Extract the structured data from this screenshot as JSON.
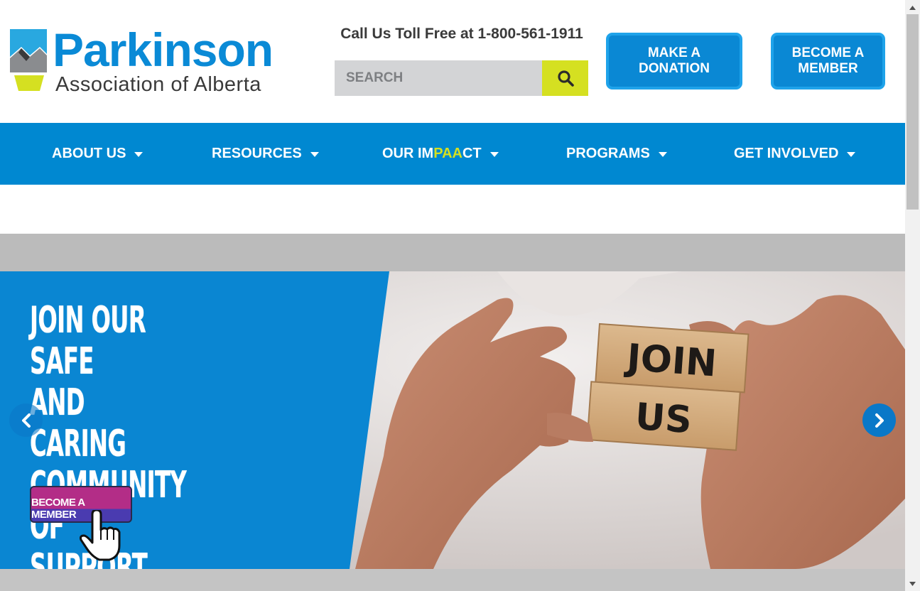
{
  "header": {
    "logo": {
      "title": "Parkinson",
      "subtitle": "Association of Alberta"
    },
    "call": "Call Us Toll Free at 1-800-561-1911",
    "search": {
      "placeholder": "SEARCH"
    },
    "donate_line1": "MAKE A",
    "donate_line2": "DONATION",
    "member_line1": "BECOME A",
    "member_line2": "MEMBER"
  },
  "nav": {
    "items": [
      {
        "label": "ABOUT US"
      },
      {
        "label": "RESOURCES"
      },
      {
        "label_a": "OUR IM",
        "label_b": "PAA",
        "label_c": "CT"
      },
      {
        "label": "PROGRAMS"
      },
      {
        "label": "GET INVOLVED"
      }
    ]
  },
  "hero": {
    "headline": [
      "JOIN OUR SAFE",
      "AND CARING",
      "COMMUNITY OF",
      "SUPPORT"
    ],
    "cta": "BECOME A MEMBER",
    "block_top": "JOIN",
    "block_bottom": "US"
  },
  "colors": {
    "brand_blue": "#0088d1",
    "accent_lime": "#d5e021",
    "cta_magenta": "#b32d87"
  },
  "icons": [
    "search-icon",
    "caret-down-icon",
    "chevron-left-icon",
    "chevron-right-icon",
    "hand-pointer-icon"
  ]
}
